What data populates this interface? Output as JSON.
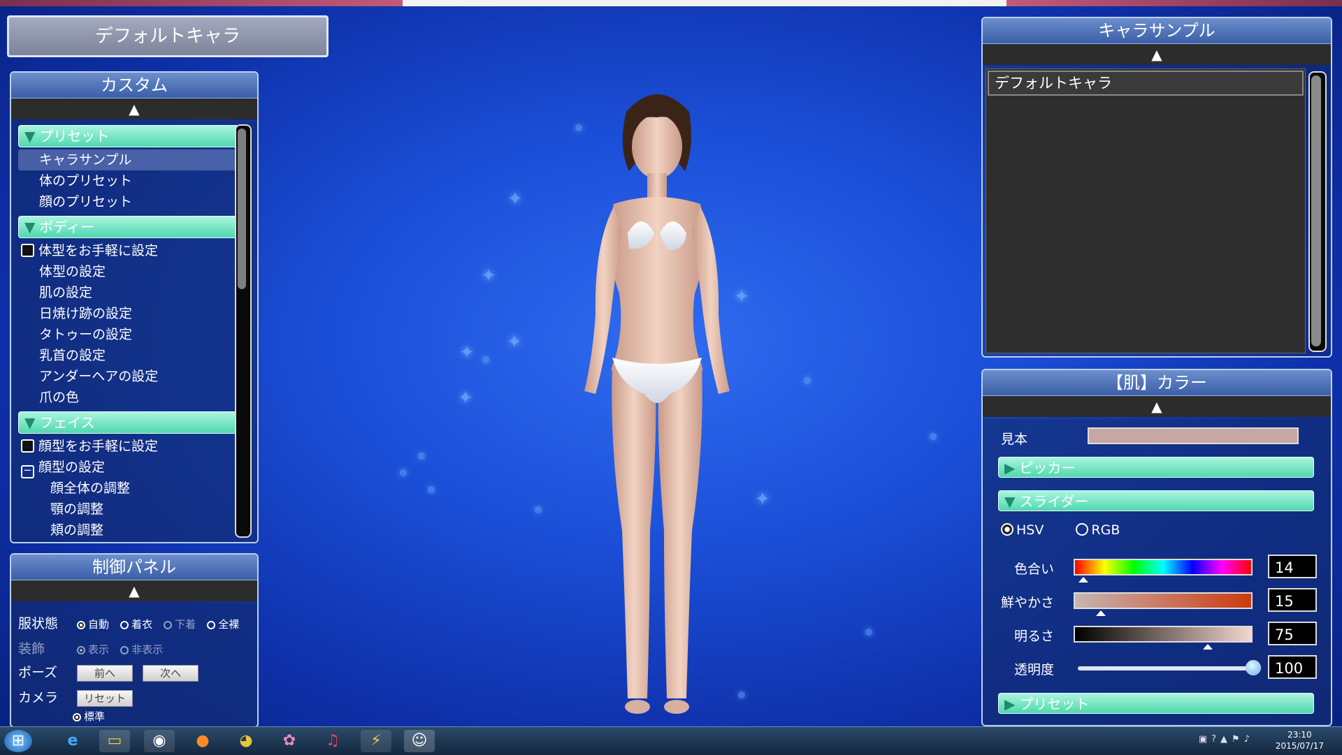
{
  "window_title": "デフォルトキャラ",
  "custom_panel": {
    "title": "カスタム",
    "collapse_icon": "triangle-up-icon",
    "sections": [
      {
        "label": "プリセット",
        "items": [
          {
            "label": "キャラサンプル",
            "selected": true
          },
          {
            "label": "体のプリセット"
          },
          {
            "label": "顔のプリセット"
          }
        ]
      },
      {
        "label": "ボディー",
        "items": [
          {
            "label": "体型をお手軽に設定",
            "checkbox": true
          },
          {
            "label": "体型の設定"
          },
          {
            "label": "肌の設定"
          },
          {
            "label": "日焼け跡の設定"
          },
          {
            "label": "タトゥーの設定"
          },
          {
            "label": "乳首の設定"
          },
          {
            "label": "アンダーヘアの設定"
          },
          {
            "label": "爪の色"
          }
        ]
      },
      {
        "label": "フェイス",
        "items": [
          {
            "label": "顔型をお手軽に設定",
            "checkbox": true
          },
          {
            "label": "顔型の設定",
            "tree": "minus"
          },
          {
            "label": "顔全体の調整",
            "sub": true
          },
          {
            "label": "顎の調整",
            "sub": true
          },
          {
            "label": "頬の調整",
            "sub": true
          }
        ]
      }
    ]
  },
  "control_panel": {
    "title": "制御パネル",
    "clothes_label": "服状態",
    "clothes_options": [
      "自動",
      "着衣",
      "下着",
      "全裸"
    ],
    "accessory_label": "装飾",
    "accessory_options": [
      "表示",
      "非表示"
    ],
    "pose_label": "ポーズ",
    "prev_label": "前へ",
    "next_label": "次へ",
    "camera_label": "カメラ",
    "reset_label": "リセット",
    "bg_option": "標準"
  },
  "sample_panel": {
    "title": "キャラサンプル",
    "items": [
      "デフォルトキャラ"
    ]
  },
  "color_panel": {
    "title": "【肌】カラー",
    "swatch_label": "見本",
    "swatch_color": "#c7a7a3",
    "picker_label": "ピッカー",
    "slider_label": "スライダー",
    "mode_hsv": "HSV",
    "mode_rgb": "RGB",
    "selected_mode": "HSV",
    "hue_label": "色合い",
    "hue_value": "14",
    "saturation_label": "鮮やかさ",
    "saturation_value": "15",
    "brightness_label": "明るさ",
    "brightness_value": "75",
    "opacity_label": "透明度",
    "opacity_value": "100",
    "preset_label": "プリセット"
  },
  "taskbar": {
    "apps": [
      "start-orb-icon",
      "internet-explorer-icon",
      "file-explorer-icon",
      "camera-icon",
      "firefox-icon",
      "chrome-icon",
      "paint-app-icon",
      "music-player-icon",
      "tool-app-icon",
      "game-app-icon"
    ],
    "time": "23:10",
    "date": "2015/07/17"
  }
}
